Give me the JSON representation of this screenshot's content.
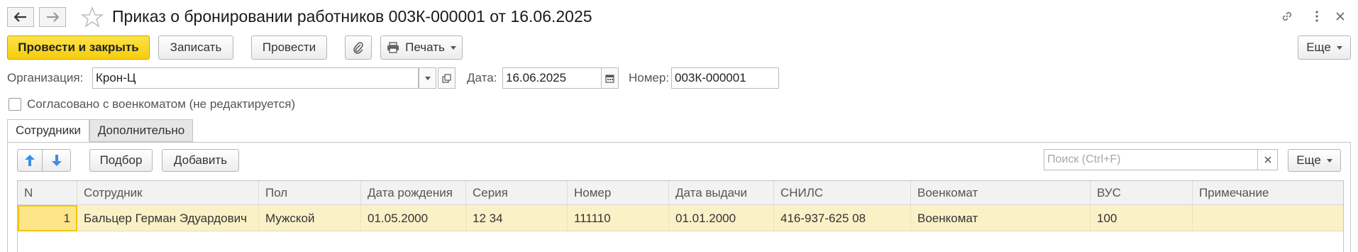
{
  "window": {
    "title": "Приказ о бронировании работников 003К-000001 от 16.06.2025",
    "link_icon": "link-icon",
    "more_icon": "vertical-dots-icon",
    "close_icon": "close-icon"
  },
  "toolbar": {
    "post_and_close": "Провести и закрыть",
    "save": "Записать",
    "post": "Провести",
    "attach_icon": "paperclip-icon",
    "print": "Печать",
    "more": "Еще"
  },
  "form": {
    "organization_label": "Организация:",
    "organization_value": "Крон-Ц",
    "date_label": "Дата:",
    "date_value": "16.06.2025",
    "number_label": "Номер:",
    "number_value": "003К-000001",
    "agreed_label": "Согласовано с военкоматом (не редактируется)",
    "agreed_checked": false
  },
  "tabs": [
    {
      "label": "Сотрудники",
      "active": true
    },
    {
      "label": "Дополнительно",
      "active": false
    }
  ],
  "table_toolbar": {
    "move_up_icon": "arrow-up-icon",
    "move_down_icon": "arrow-down-icon",
    "pick": "Подбор",
    "add": "Добавить",
    "search_placeholder": "Поиск (Ctrl+F)",
    "more": "Еще"
  },
  "table": {
    "columns": [
      "N",
      "Сотрудник",
      "Пол",
      "Дата рождения",
      "Серия",
      "Номер",
      "Дата выдачи",
      "СНИЛС",
      "Военкомат",
      "ВУС",
      "Примечание"
    ],
    "rows": [
      [
        "1",
        "Бальцер Герман Эдуардович",
        "Мужской",
        "01.05.2000",
        "12 34",
        "111110",
        "01.01.2000",
        "416-937-625 08",
        "Военкомат",
        "100",
        ""
      ]
    ]
  },
  "colors": {
    "primary_button": "#f5cd0c",
    "selected_row": "#fbf1c7",
    "move_arrows": "#3a8ee6"
  }
}
